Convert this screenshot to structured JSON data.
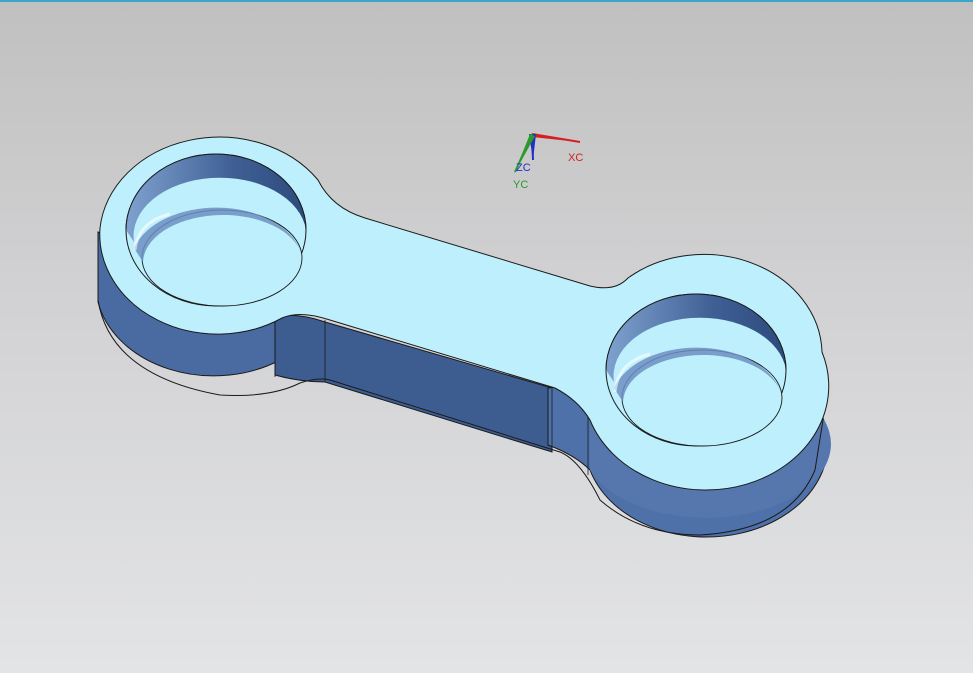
{
  "viewport": {
    "background_top": "#c0c0c0",
    "background_bottom": "#e3e4e6",
    "accent_line": "#3ba6c8"
  },
  "model": {
    "top_face_color": "#bdf0fc",
    "side_face_color": "#3f5f93",
    "inner_wall_color": "#4a6aa0",
    "edge_color": "#1a1a1a"
  },
  "triad": {
    "x_label": "XC",
    "y_label": "YC",
    "z_label": "ZC",
    "x_color": "#d42020",
    "y_color": "#2a9a2a",
    "z_color": "#2030c8"
  }
}
